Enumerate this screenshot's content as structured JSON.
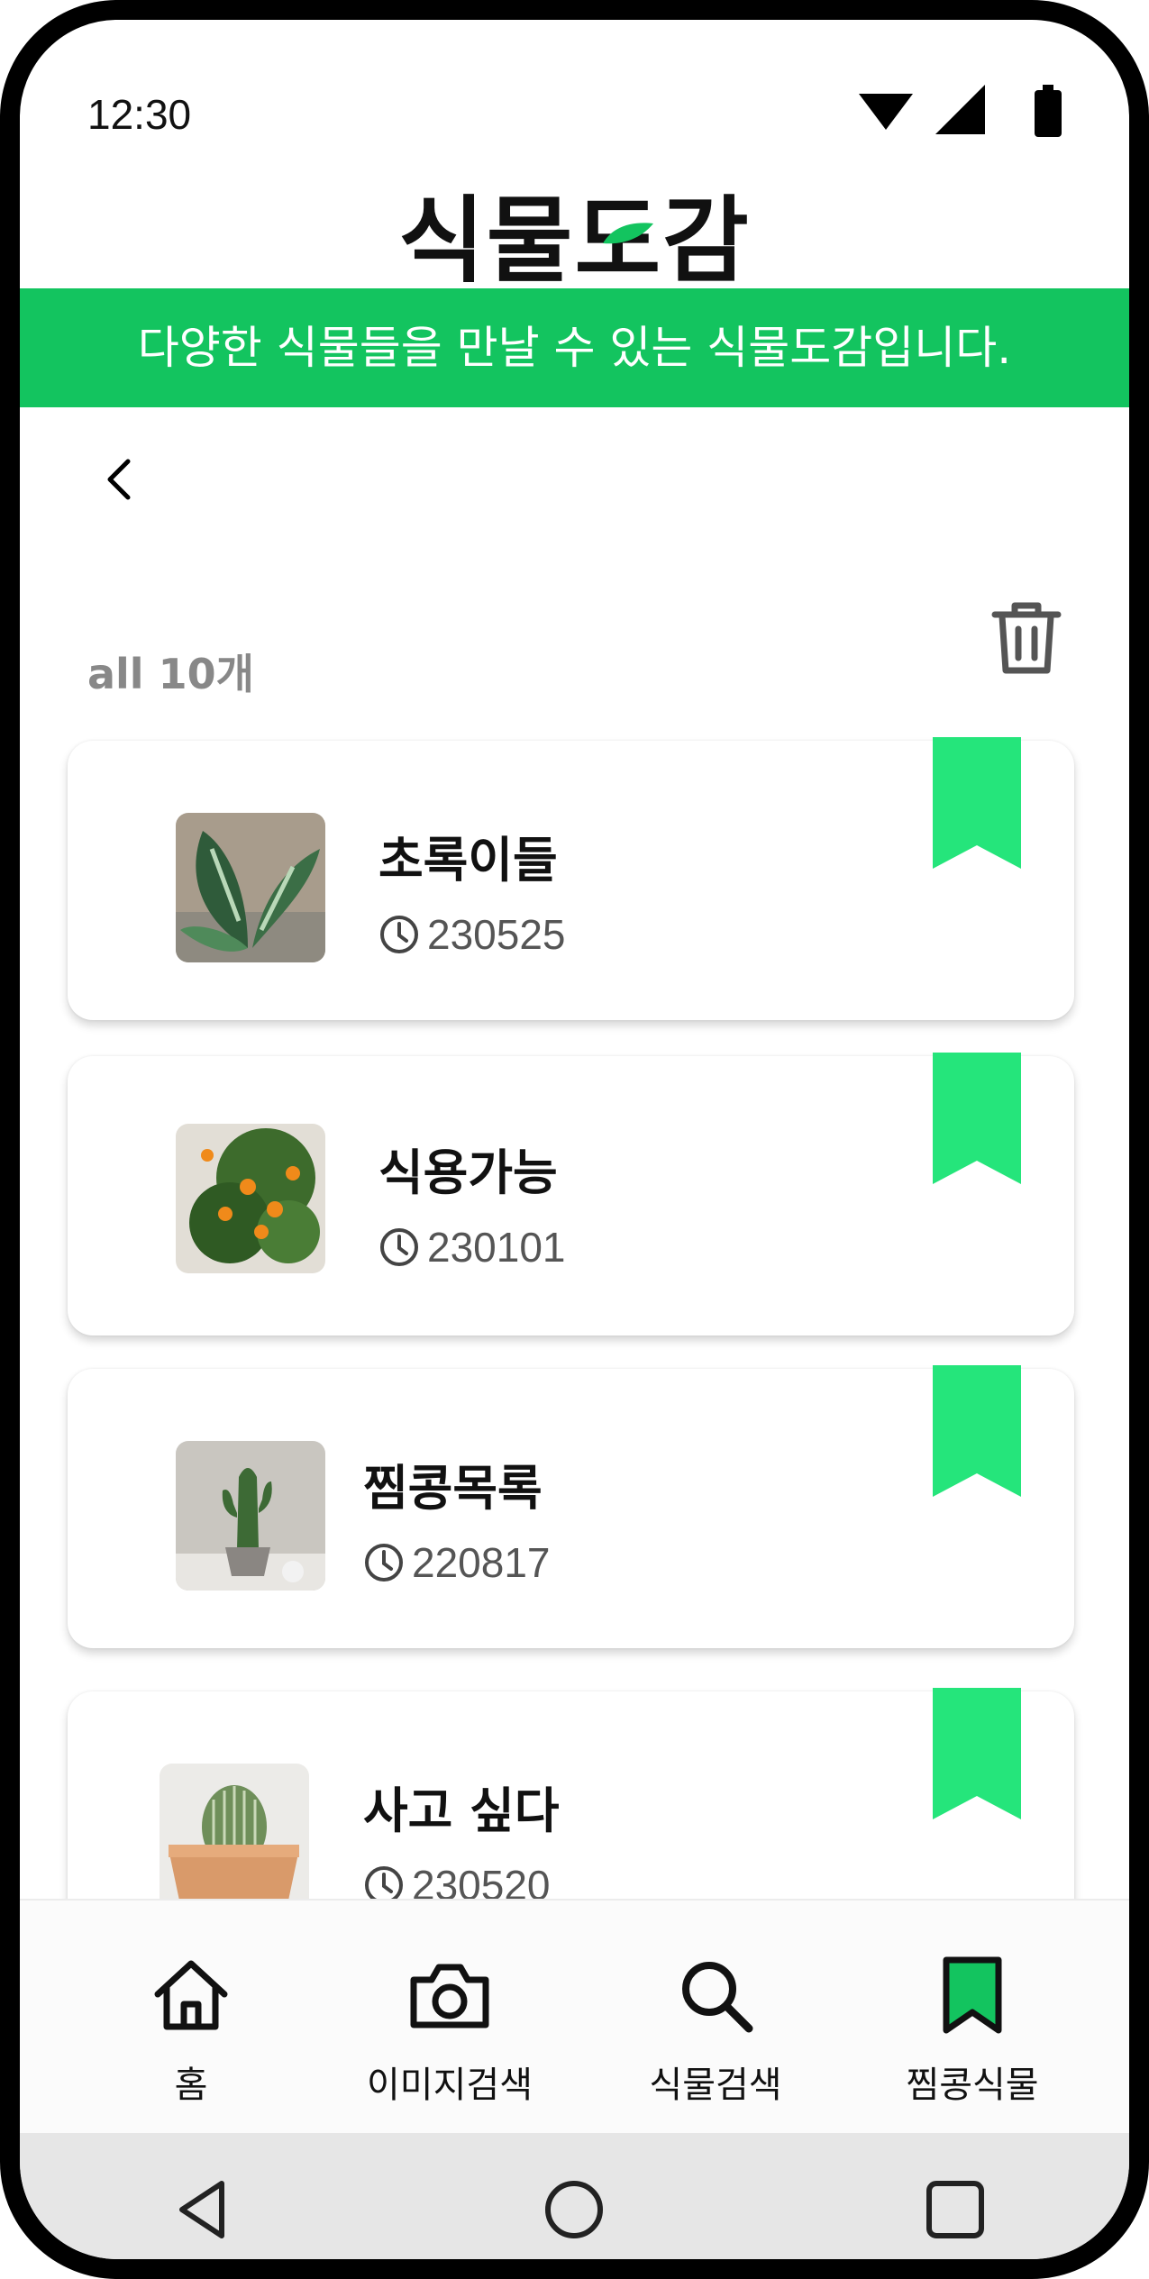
{
  "status_bar": {
    "time": "12:30",
    "icons": [
      "wifi-icon",
      "signal-icon",
      "battery-icon"
    ]
  },
  "app": {
    "title": "식물도감",
    "accent_color": "#13c45f",
    "bookmark_color": "#25e57b"
  },
  "banner": {
    "text": "다양한 식물들을 만날 수 있는 식물도감입니다."
  },
  "list_header": {
    "count_label": "all 10개"
  },
  "cards": [
    {
      "title": "초록이들",
      "date": "230525",
      "image": "aglaonema-plant"
    },
    {
      "title": "식용가능",
      "date": "230101",
      "image": "kumquat-tree"
    },
    {
      "title": "찜콩목록",
      "date": "220817",
      "image": "cactus-pot"
    },
    {
      "title": "사고 싶다",
      "date": "230520",
      "image": "round-cactus-terracotta"
    }
  ],
  "bottom_nav": {
    "items": [
      {
        "label": "홈",
        "icon": "home-icon"
      },
      {
        "label": "이미지검색",
        "icon": "camera-icon"
      },
      {
        "label": "식물검색",
        "icon": "search-icon"
      },
      {
        "label": "찜콩식물",
        "icon": "bookmark-icon",
        "active": true
      }
    ]
  },
  "system_nav": [
    "back-triangle-icon",
    "home-circle-icon",
    "recents-square-icon"
  ]
}
